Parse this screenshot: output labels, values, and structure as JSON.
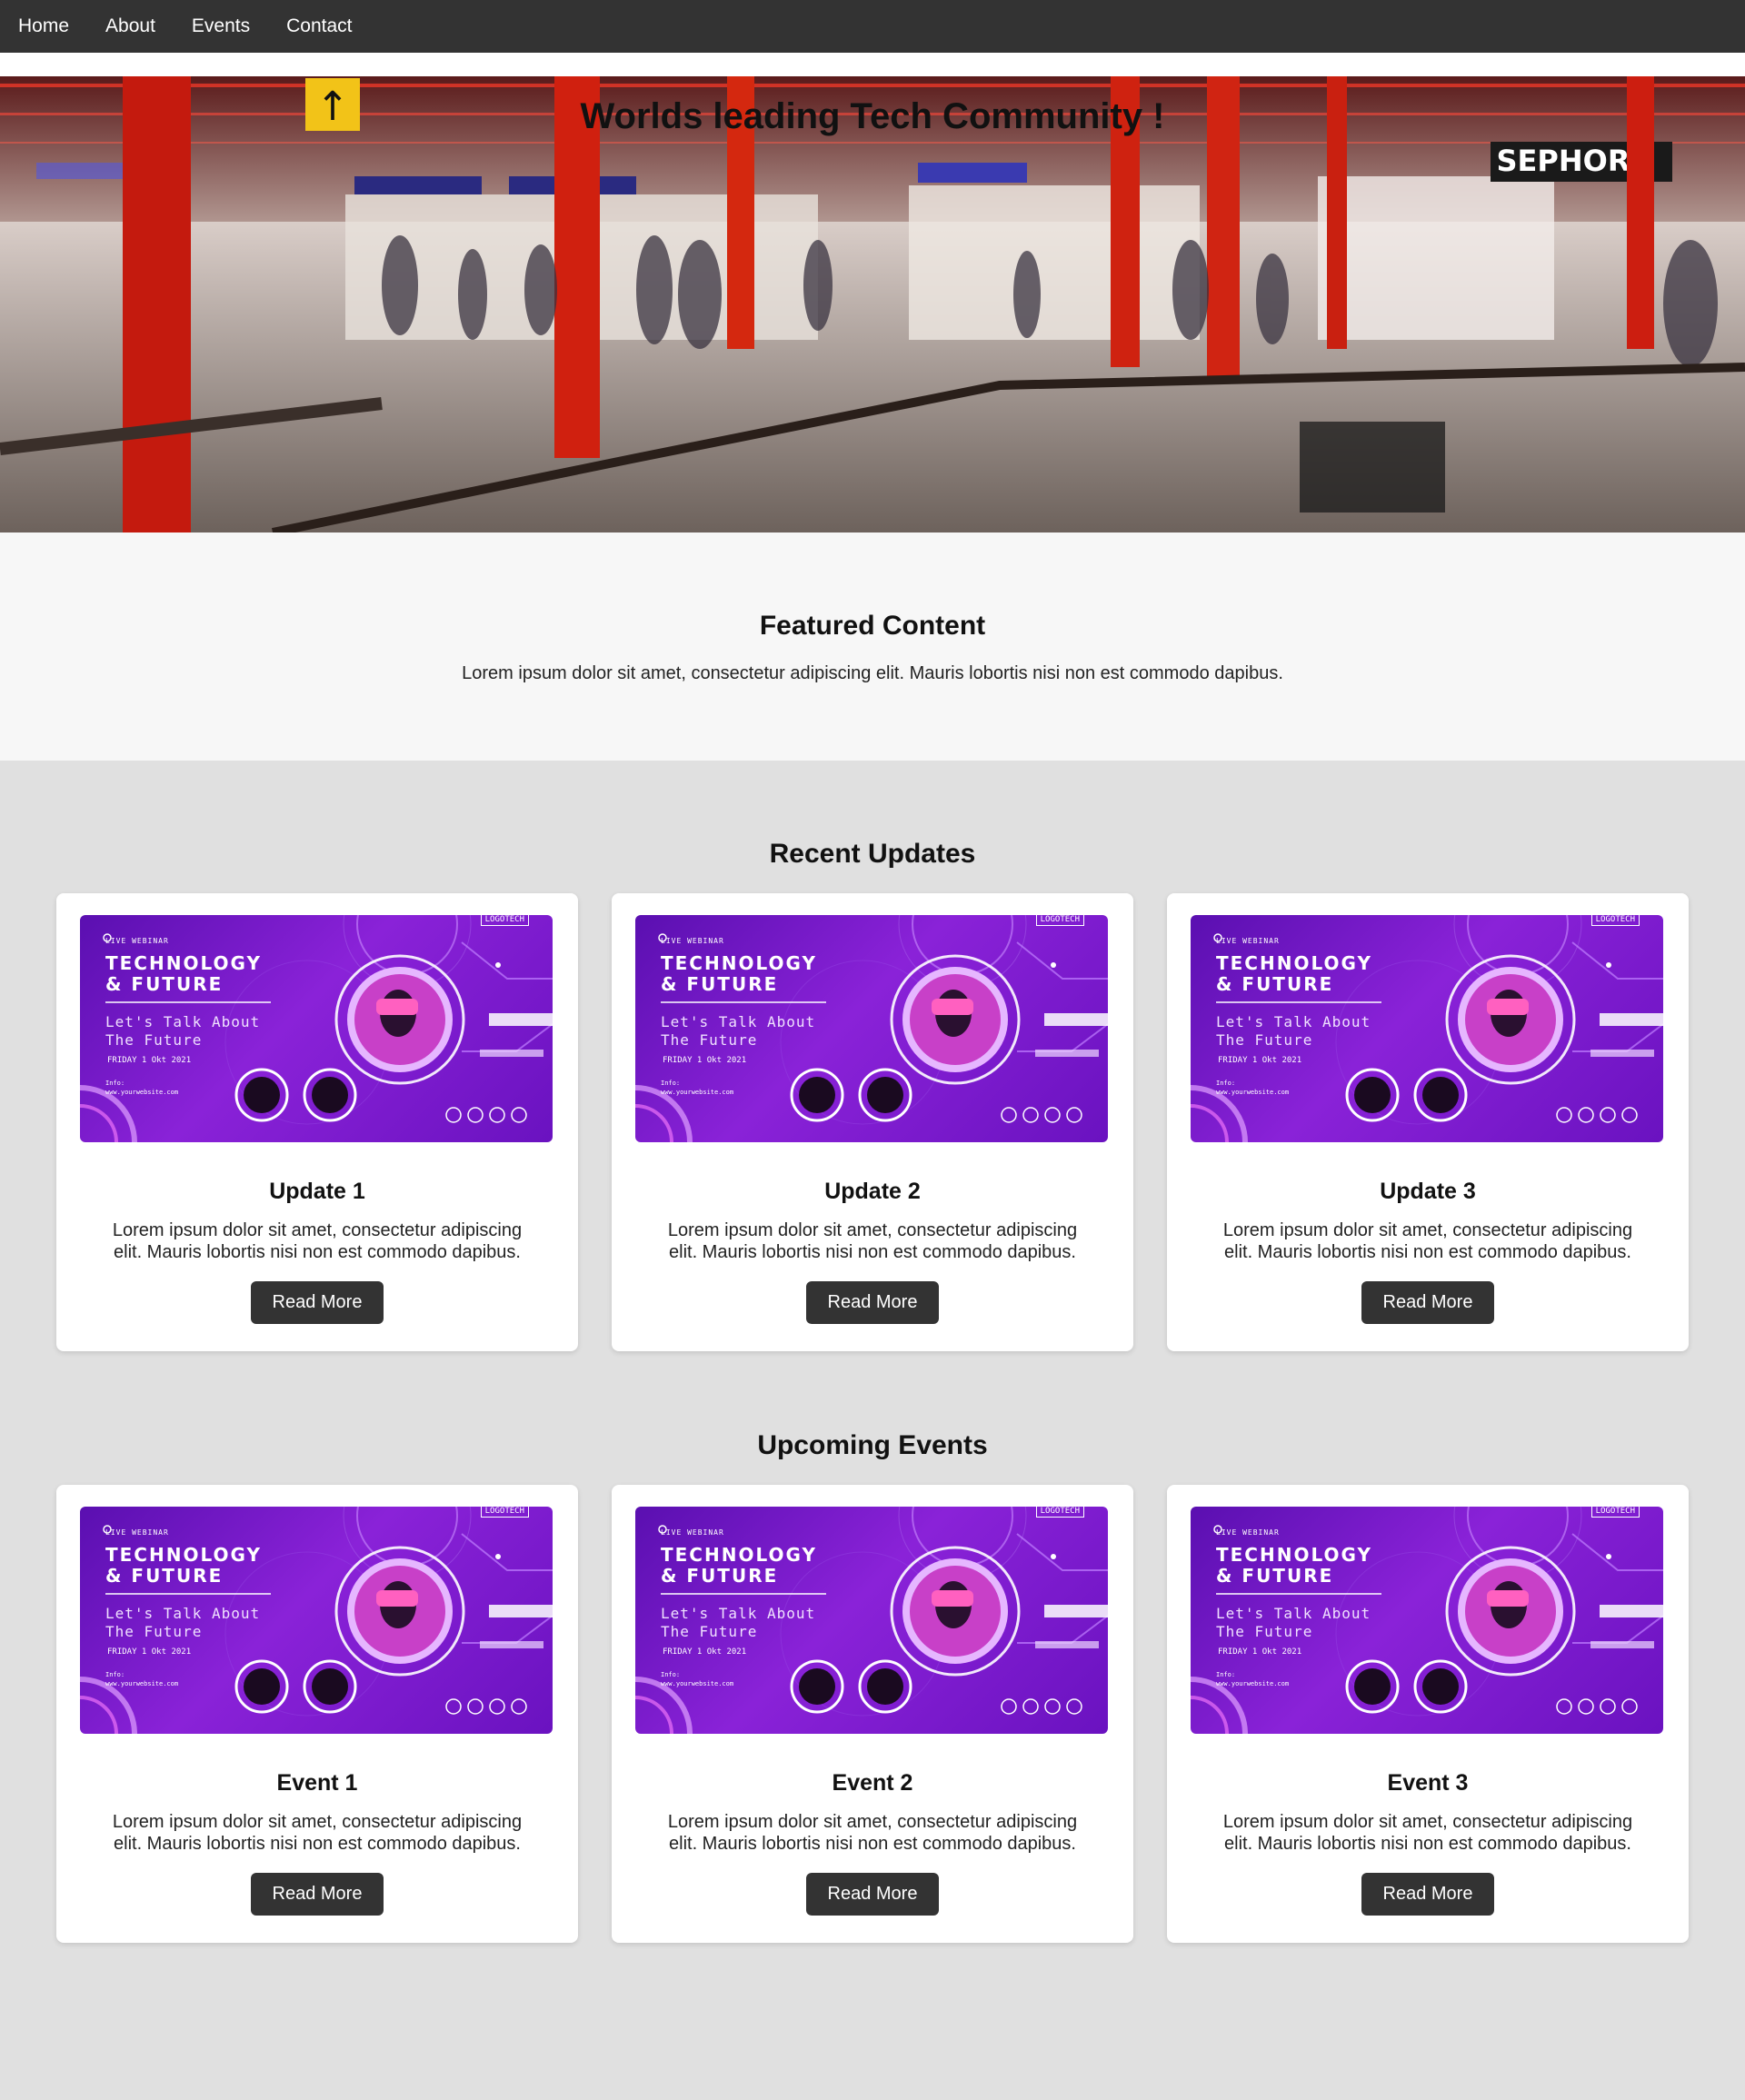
{
  "nav": {
    "items": [
      {
        "label": "Home"
      },
      {
        "label": "About"
      },
      {
        "label": "Events"
      },
      {
        "label": "Contact"
      }
    ]
  },
  "hero": {
    "title": "Worlds leading Tech Community !",
    "sign_text": "SEPHOR"
  },
  "featured": {
    "title": "Featured Content",
    "text": "Lorem ipsum dolor sit amet, consectetur adipiscing elit. Mauris lobortis nisi non est commodo dapibus."
  },
  "banner": {
    "live": "LIVE WEBINAR",
    "title_line1": "TECHNOLOGY",
    "title_line2": "& FUTURE",
    "sub_line1": "Let's Talk About",
    "sub_line2": "The Future",
    "date": "FRIDAY 1 Okt 2021",
    "info_label": "Info:",
    "info_url": "www.yourwebsite.com",
    "logo": "LOGOTECH"
  },
  "updates": {
    "title": "Recent Updates",
    "cards": [
      {
        "title": "Update 1",
        "text": "Lorem ipsum dolor sit amet, consectetur adipiscing elit. Mauris lobortis nisi non est commodo dapibus.",
        "button": "Read More"
      },
      {
        "title": "Update 2",
        "text": "Lorem ipsum dolor sit amet, consectetur adipiscing elit. Mauris lobortis nisi non est commodo dapibus.",
        "button": "Read More"
      },
      {
        "title": "Update 3",
        "text": "Lorem ipsum dolor sit amet, consectetur adipiscing elit. Mauris lobortis nisi non est commodo dapibus.",
        "button": "Read More"
      }
    ]
  },
  "events": {
    "title": "Upcoming Events",
    "cards": [
      {
        "title": "Event 1",
        "text": "Lorem ipsum dolor sit amet, consectetur adipiscing elit. Mauris lobortis nisi non est commodo dapibus.",
        "button": "Read More"
      },
      {
        "title": "Event 2",
        "text": "Lorem ipsum dolor sit amet, consectetur adipiscing elit. Mauris lobortis nisi non est commodo dapibus.",
        "button": "Read More"
      },
      {
        "title": "Event 3",
        "text": "Lorem ipsum dolor sit amet, consectetur adipiscing elit. Mauris lobortis nisi non est commodo dapibus.",
        "button": "Read More"
      }
    ]
  },
  "colors": {
    "nav_bg": "#333333",
    "button_bg": "#333333",
    "section_bg": "#e0e0e0",
    "featured_bg": "#f7f7f7",
    "banner_purple": "#7a1ccc"
  }
}
